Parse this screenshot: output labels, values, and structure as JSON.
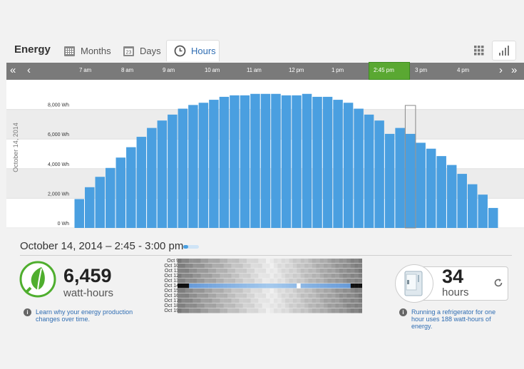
{
  "header": {
    "brand": "Energy",
    "tabs": [
      {
        "label": "Months",
        "icon": "calendar-month-icon"
      },
      {
        "label": "Days",
        "icon": "calendar-day-icon",
        "badge": "23"
      },
      {
        "label": "Hours",
        "icon": "clock-icon",
        "active": true
      }
    ],
    "view_toggles": [
      "grid-view-icon",
      "bar-chart-view-icon"
    ]
  },
  "timeline": {
    "labels": [
      "7 am",
      "8 am",
      "9 am",
      "10 am",
      "11 am",
      "12 pm",
      "1 pm",
      "2:45 pm",
      "3 pm",
      "4 pm"
    ],
    "selected": "2:45 pm",
    "selected_color": "#5aa832"
  },
  "chart_data": {
    "type": "bar",
    "ylabel": "October 14, 2014",
    "ylim": [
      0,
      10000
    ],
    "y_ticks": [
      "0 Wh",
      "2,000 Wh",
      "4,000 Wh",
      "6,000 Wh",
      "8,000 Wh"
    ],
    "y_tick_values": [
      0,
      2000,
      4000,
      6000,
      8000
    ],
    "bar_color": "#4a9fe0",
    "grid": true,
    "x_start": "6:45 am",
    "interval": "15 min",
    "values": [
      1950,
      2750,
      3450,
      4050,
      4750,
      5450,
      6150,
      6750,
      7250,
      7650,
      8050,
      8300,
      8450,
      8650,
      8850,
      8950,
      8950,
      9050,
      9050,
      9050,
      8950,
      8950,
      9050,
      8850,
      8850,
      8650,
      8450,
      8050,
      7650,
      7250,
      6350,
      6750,
      6350,
      5750,
      5350,
      4850,
      4250,
      3650,
      2950,
      2250,
      1350
    ],
    "selected_index": 32
  },
  "detail": {
    "title": "October 14, 2014 – 2:45 - 3:00 pm",
    "energy_value": "6,459",
    "energy_unit": "watt-hours",
    "energy_info": "Learn why your energy production changes over time.",
    "heatmap_days": [
      "Oct 9",
      "Oct 10",
      "Oct 11",
      "Oct 12",
      "Oct 13",
      "Oct 14",
      "Oct 15",
      "Oct 16",
      "Oct 17",
      "Oct 18",
      "Oct 19"
    ],
    "heatmap_selected_day": "Oct 14",
    "appliance_value": "34",
    "appliance_unit": "hours",
    "appliance_info": "Running a refrigerator for one hour uses 188 watt-hours of energy.",
    "leaf_color": "#4fae2e"
  }
}
